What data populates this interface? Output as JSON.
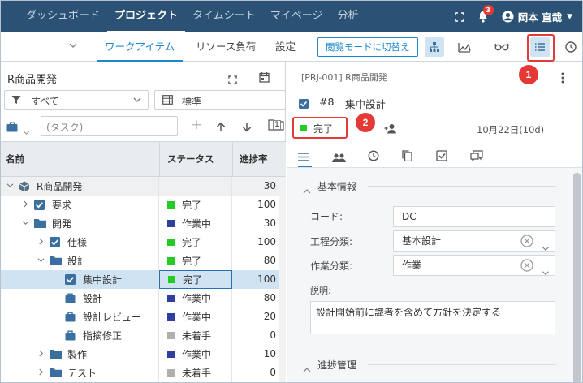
{
  "topnav": {
    "items": [
      "ダッシュボード",
      "プロジェクト",
      "タイムシート",
      "マイページ",
      "分析"
    ],
    "badge": "3",
    "user": "岡本 直哉"
  },
  "subbar": {
    "tabs": [
      "ワークアイテム",
      "リソース負荷",
      "設定"
    ],
    "mode_button": "閲覧モードに切替え"
  },
  "annotations": {
    "one": "1",
    "two": "2"
  },
  "left": {
    "title": "R商品開発",
    "filter": "すべて",
    "view": "標準",
    "task_placeholder": "(タスク)",
    "date_badge": "1",
    "columns": {
      "name": "名前",
      "status": "ステータス",
      "progress": "進捗率"
    },
    "rows": [
      {
        "name": "R商品開発",
        "status": "",
        "progress": "30",
        "level": 0,
        "exp": "v",
        "icon": "project"
      },
      {
        "name": "要求",
        "status": "完了",
        "progress": "100",
        "level": 1,
        "exp": ">",
        "icon": "check",
        "color": "#22cc22"
      },
      {
        "name": "開発",
        "status": "作業中",
        "progress": "30",
        "level": 1,
        "exp": "v",
        "icon": "folder",
        "color": "#2e3f9e"
      },
      {
        "name": "仕様",
        "status": "完了",
        "progress": "100",
        "level": 2,
        "exp": ">",
        "icon": "check",
        "color": "#22cc22"
      },
      {
        "name": "設計",
        "status": "完了",
        "progress": "80",
        "level": 2,
        "exp": "v",
        "icon": "folder",
        "color": "#22cc22"
      },
      {
        "name": "集中設計",
        "status": "完了",
        "progress": "100",
        "level": 3,
        "exp": "",
        "icon": "check",
        "color": "#22cc22"
      },
      {
        "name": "設計",
        "status": "作業中",
        "progress": "80",
        "level": 3,
        "exp": "",
        "icon": "bag",
        "color": "#2e3f9e"
      },
      {
        "name": "設計レビュー",
        "status": "作業中",
        "progress": "20",
        "level": 3,
        "exp": "",
        "icon": "bag",
        "color": "#2e3f9e"
      },
      {
        "name": "指摘修正",
        "status": "未着手",
        "progress": "0",
        "level": 3,
        "exp": "",
        "icon": "bag",
        "color": "#b0b0b0"
      },
      {
        "name": "製作",
        "status": "作業中",
        "progress": "10",
        "level": 2,
        "exp": ">",
        "icon": "folder",
        "color": "#2e3f9e"
      },
      {
        "name": "テスト",
        "status": "未着手",
        "progress": "0",
        "level": 2,
        "exp": ">",
        "icon": "folder",
        "color": "#b0b0b0"
      }
    ]
  },
  "right": {
    "breadcrumb": "[PRJ-001] R商品開発",
    "item_no": "#8",
    "item_title": "集中設計",
    "status": "完了",
    "date": "10月22日(10d)",
    "section1": "基本情報",
    "section2": "進捗管理",
    "fields": {
      "code_label": "コード:",
      "code": "DC",
      "process_label": "工程分類:",
      "process": "基本設計",
      "work_label": "作業分類:",
      "work": "作業",
      "desc_label": "説明:",
      "desc": "設計開始前に識者を含めて方針を決定する"
    }
  }
}
